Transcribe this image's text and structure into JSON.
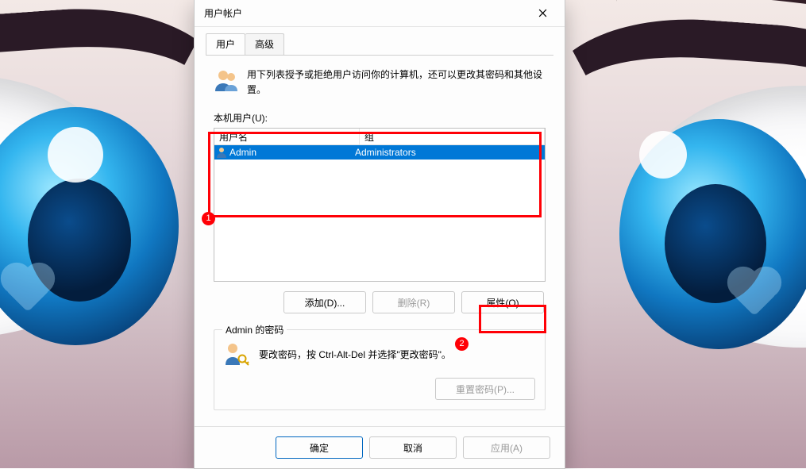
{
  "dialog": {
    "title": "用户帐户",
    "tabs": {
      "users": "用户",
      "advanced": "高级"
    },
    "info_text": "用下列表授予或拒绝用户访问你的计算机，还可以更改其密码和其他设置。",
    "list_label": "本机用户(U):",
    "columns": {
      "username": "用户名",
      "group": "组"
    },
    "rows": [
      {
        "username": "Admin",
        "group": "Administrators"
      }
    ],
    "buttons": {
      "add": "添加(D)...",
      "remove": "删除(R)",
      "properties": "属性(O)"
    },
    "group": {
      "legend": "Admin 的密码",
      "text": "要改密码，按 Ctrl-Alt-Del 并选择\"更改密码\"。",
      "reset": "重置密码(P)..."
    },
    "footer": {
      "ok": "确定",
      "cancel": "取消",
      "apply": "应用(A)"
    }
  },
  "annotations": {
    "dot1": "1",
    "dot2": "2"
  }
}
